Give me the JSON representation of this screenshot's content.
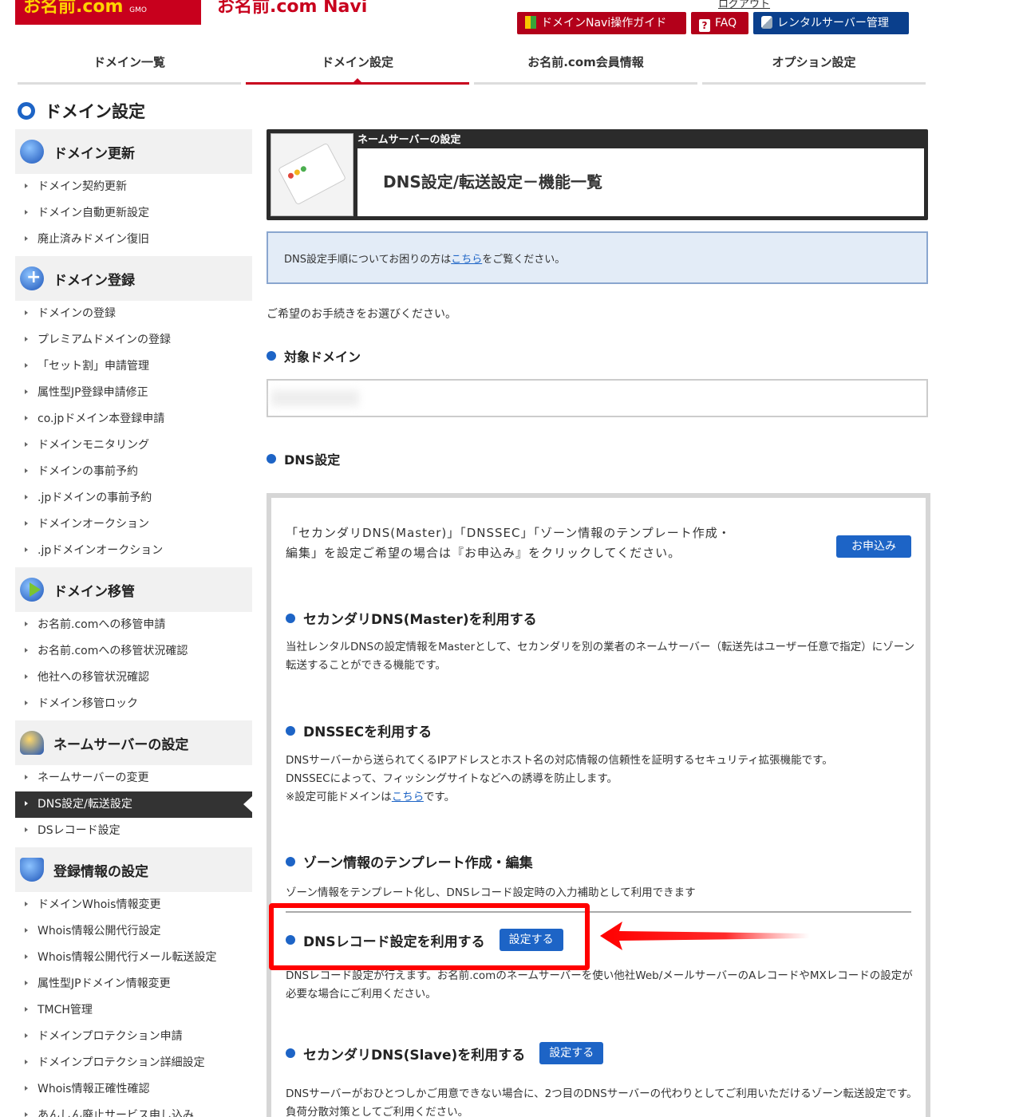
{
  "header": {
    "logo_text": "お名前.com",
    "logo_sub": "GMO",
    "app_title": "お名前.com Navi",
    "top_right_text": "ログアウト",
    "buttons": {
      "guide": "ドメインNavi操作ガイド",
      "faq": "FAQ",
      "rental": "レンタルサーバー管理"
    }
  },
  "tabs": [
    {
      "label": "ドメイン一覧"
    },
    {
      "label": "ドメイン設定"
    },
    {
      "label": "お名前.com会員情報"
    },
    {
      "label": "オプション設定"
    }
  ],
  "page_title": "ドメイン設定",
  "sidebar": {
    "sections": [
      {
        "title": "ドメイン更新",
        "icon": "globe-refresh-icon",
        "items": [
          "ドメイン契約更新",
          "ドメイン自動更新設定",
          "廃止済みドメイン復旧"
        ]
      },
      {
        "title": "ドメイン登録",
        "icon": "globe-plus-icon",
        "items": [
          "ドメインの登録",
          "プレミアムドメインの登録",
          "「セット割」申請管理",
          "属性型JP登録申請修正",
          "co.jpドメイン本登録申請",
          "ドメインモニタリング",
          "ドメインの事前予約",
          ".jpドメインの事前予約",
          "ドメインオークション",
          ".jpドメインオークション"
        ]
      },
      {
        "title": "ドメイン移管",
        "icon": "globe-transfer-icon",
        "items": [
          "お名前.comへの移管申請",
          "お名前.comへの移管状況確認",
          "他社への移管状況確認",
          "ドメイン移管ロック"
        ]
      },
      {
        "title": "ネームサーバーの設定",
        "icon": "nameserver-icon",
        "items": [
          "ネームサーバーの変更",
          "DNS設定/転送設定",
          "DSレコード設定"
        ]
      },
      {
        "title": "登録情報の設定",
        "icon": "registration-icon",
        "items": [
          "ドメインWhois情報変更",
          "Whois情報公開代行設定",
          "Whois情報公開代行メール転送設定",
          "属性型JPドメイン情報変更",
          "TMCH管理",
          "ドメインプロテクション申請",
          "ドメインプロテクション詳細設定",
          "Whois情報正確性確認",
          "あんしん廃止サービス申し込み"
        ]
      }
    ],
    "active_item": "DNS設定/転送設定"
  },
  "main": {
    "hero_small": "ネームサーバーの設定",
    "hero_title": "DNS設定/転送設定－機能一覧",
    "help_before": "DNS設定手順についてお困りの方は",
    "help_link": "こちら",
    "help_after": "をご覧ください。",
    "intro": "ご希望のお手続きをお選びください。",
    "target_domain_heading": "対象ドメイン",
    "dns_heading": "DNS設定",
    "notice": "「セカンダリDNS(Master)」「DNSSEC」「ゾーン情報のテンプレート作成・編集」を設定ご希望の場合は『お申込み』をクリックしてください。",
    "apply_button": "お申込み",
    "features": [
      {
        "title": "セカンダリDNS(Master)を利用する",
        "desc": "当社レンタルDNSの設定情報をMasterとして、セカンダリを別の業者のネームサーバー（転送先はユーザー任意で指定）にゾーン転送することができる機能です。"
      },
      {
        "title": "DNSSECを利用する",
        "desc1": "DNSサーバーから送られてくるIPアドレスとホスト名の対応情報の信頼性を証明するセキュリティ拡張機能です。",
        "desc2": "DNSSECによって、フィッシングサイトなどへの誘導を防止します。",
        "desc3_before": "※設定可能ドメインは",
        "desc3_link": "こちら",
        "desc3_after": "です。"
      },
      {
        "title": "ゾーン情報のテンプレート作成・編集",
        "desc": "ゾーン情報をテンプレート化し、DNSレコード設定時の入力補助として利用できます"
      },
      {
        "title": "DNSレコード設定を利用する",
        "button": "設定する",
        "desc": "DNSレコード設定が行えます。お名前.comのネームサーバーを使い他社Web/メールサーバーのAレコードやMXレコードの設定が必要な場合にご利用ください。"
      },
      {
        "title": "セカンダリDNS(Slave)を利用する",
        "button": "設定する",
        "desc": "DNSサーバーがおひとつしかご用意できない場合に、2つ目のDNSサーバーの代わりとしてご利用いただけるゾーン転送設定です。負荷分散対策としてご利用ください。"
      }
    ]
  },
  "colors": {
    "brand_red": "#c8001d",
    "accent_blue": "#1d64c6",
    "highlight": "#ff0000"
  }
}
